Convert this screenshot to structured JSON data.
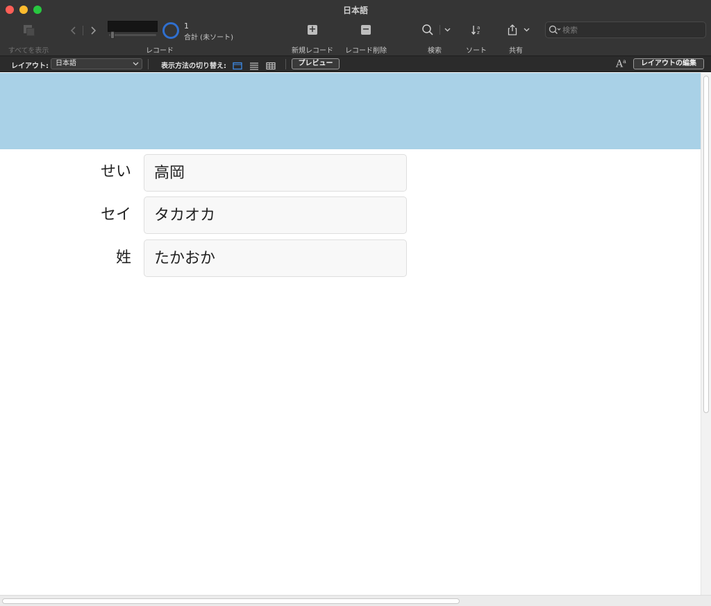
{
  "window": {
    "title": "日本語"
  },
  "toolbar": {
    "show_all_label": "すべてを表示",
    "record_label": "レコード",
    "record_count": "1",
    "record_total": "合計 (未ソート)",
    "new_record_label": "新規レコード",
    "delete_record_label": "レコード削除",
    "find_label": "検索",
    "sort_label": "ソート",
    "share_label": "共有",
    "search_placeholder": "検索"
  },
  "layout_bar": {
    "layout_label": "レイアウト:",
    "layout_selected": "日本語",
    "view_as_label": "表示方法の切り替え:",
    "preview_button": "プレビュー",
    "edit_layout_button": "レイアウトの編集"
  },
  "record": {
    "fields": [
      {
        "label": "せい",
        "value": "高岡"
      },
      {
        "label": "セイ",
        "value": "タカオカ"
      },
      {
        "label": "姓",
        "value": "たかおか"
      }
    ]
  },
  "colors": {
    "header_band": "#a9d1e7",
    "toolbar_bg": "#353535",
    "accent": "#2f6fcf"
  }
}
